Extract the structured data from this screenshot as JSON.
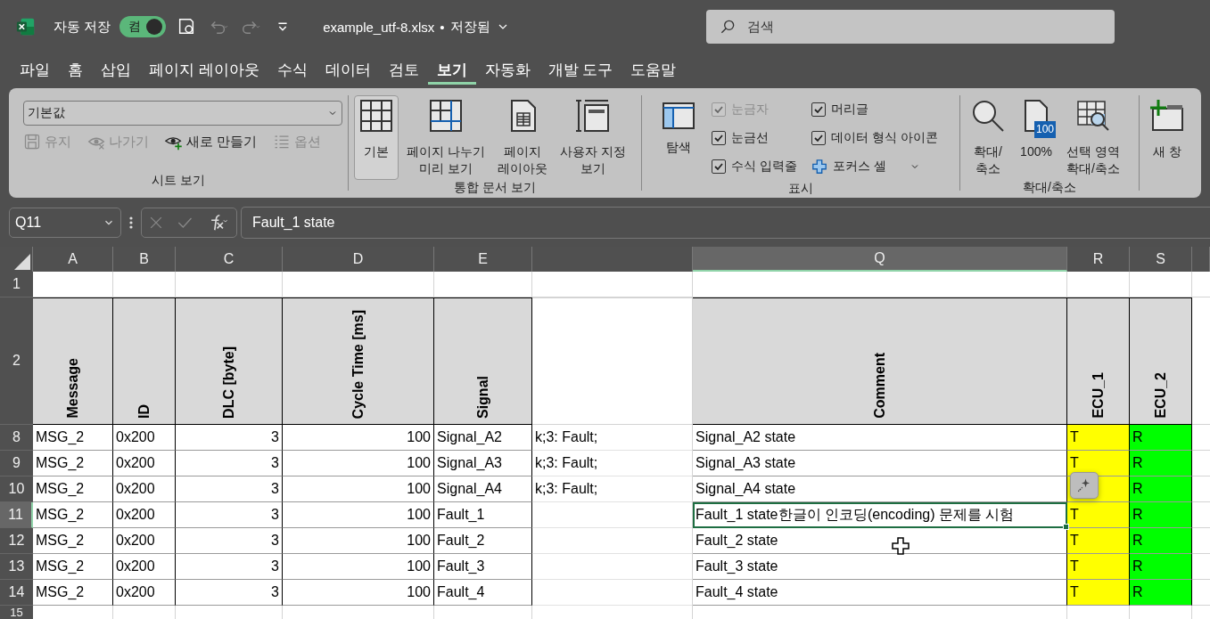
{
  "title_bar": {
    "autosave_label": "자동 저장",
    "autosave": {
      "label": "켬",
      "on": true
    },
    "file_name": "example_utf-8.xlsx",
    "separator": "•",
    "save_status": "저장됨",
    "search_placeholder": "검색"
  },
  "menu": [
    {
      "label": "파일",
      "selected": false
    },
    {
      "label": "홈",
      "selected": false
    },
    {
      "label": "삽입",
      "selected": false
    },
    {
      "label": "페이지 레이아웃",
      "selected": false
    },
    {
      "label": "수식",
      "selected": false
    },
    {
      "label": "데이터",
      "selected": false
    },
    {
      "label": "검토",
      "selected": false
    },
    {
      "label": "보기",
      "selected": true
    },
    {
      "label": "자동화",
      "selected": false
    },
    {
      "label": "개발 도구",
      "selected": false
    },
    {
      "label": "도움말",
      "selected": false
    }
  ],
  "ribbon": {
    "sheet_view": {
      "title": "시트 보기",
      "view_select": "기본값",
      "buttons": [
        {
          "label": "유지",
          "disabled": true
        },
        {
          "label": "나가기",
          "disabled": true
        },
        {
          "label": "새로 만들기",
          "disabled": false
        },
        {
          "label": "옵션",
          "disabled": true
        }
      ]
    },
    "workbook_views": {
      "title": "통합 문서 보기",
      "buttons": [
        {
          "lines": [
            "기본"
          ],
          "selected": true
        },
        {
          "lines": [
            "페이지 나누기",
            "미리 보기"
          ],
          "selected": false
        },
        {
          "lines": [
            "페이지",
            "레이아웃"
          ],
          "selected": false
        },
        {
          "lines": [
            "사용자 지정",
            "보기"
          ],
          "selected": false
        }
      ]
    },
    "show": {
      "title": "표시",
      "navigation": {
        "label": "탐색"
      },
      "checks": [
        {
          "label": "눈금자",
          "checked": true,
          "disabled": true
        },
        {
          "label": "눈금선",
          "checked": true,
          "disabled": false
        },
        {
          "label": "수식 입력줄",
          "checked": true,
          "disabled": false
        },
        {
          "label": "머리글",
          "checked": true,
          "disabled": false
        },
        {
          "label": "데이터 형식 아이콘",
          "checked": true,
          "disabled": false
        }
      ],
      "focus_cell": {
        "label": "포커스 셀"
      }
    },
    "zoom": {
      "title": "확대/축소",
      "buttons": [
        {
          "lines": [
            "확대/",
            "축소"
          ]
        },
        {
          "lines": [
            "100%"
          ],
          "badge": "100"
        },
        {
          "lines": [
            "선택 영역",
            "확대/축소"
          ]
        }
      ]
    },
    "window": {
      "buttons": [
        {
          "lines": [
            "새 창"
          ]
        }
      ]
    }
  },
  "formula_bar": {
    "name_box": "Q11",
    "formula": "Fault_1 state"
  },
  "sheet": {
    "columns": [
      {
        "label": "A",
        "kind": "text"
      },
      {
        "label": "B",
        "kind": "text"
      },
      {
        "label": "C",
        "kind": "number"
      },
      {
        "label": "D",
        "kind": "number"
      },
      {
        "label": "E",
        "kind": "text"
      },
      {
        "kind": "text"
      },
      {
        "label": "Q",
        "kind": "text"
      },
      {
        "label": "R",
        "kind": "text"
      },
      {
        "label": "S",
        "kind": "text"
      }
    ],
    "rows": [
      {
        "number": "1",
        "kind": "empty"
      },
      {
        "number": "2",
        "kind": "header",
        "cells": [
          {
            "text": "Message"
          },
          {
            "text": "ID"
          },
          {
            "text": "DLC [byte]"
          },
          {
            "text": "Cycle Time [ms]"
          },
          {
            "text": "Signal"
          },
          {},
          {
            "text": "Comment"
          },
          {
            "text": "ECU_1"
          },
          {
            "text": "ECU_2"
          }
        ]
      },
      {
        "number": "8",
        "kind": "data",
        "cells": [
          {
            "text": "MSG_2",
            "selected": false
          },
          {
            "text": "0x200",
            "selected": false
          },
          {
            "text": "3",
            "selected": false
          },
          {
            "text": "100",
            "selected": false
          },
          {
            "text": "Signal_A2",
            "selected": false
          },
          {
            "text": "k;3: Fault;",
            "selected": false
          },
          {
            "text": "Signal_A2 state",
            "selected": false
          },
          {
            "text": "T",
            "color": "#ffff00",
            "selected": false
          },
          {
            "text": "R",
            "color": "#00ff00",
            "selected": false
          }
        ]
      },
      {
        "number": "9",
        "kind": "data",
        "cells": [
          {
            "text": "MSG_2",
            "selected": false
          },
          {
            "text": "0x200",
            "selected": false
          },
          {
            "text": "3",
            "selected": false
          },
          {
            "text": "100",
            "selected": false
          },
          {
            "text": "Signal_A3",
            "selected": false
          },
          {
            "text": "k;3: Fault;",
            "selected": false
          },
          {
            "text": "Signal_A3 state",
            "selected": false
          },
          {
            "text": "T",
            "color": "#ffff00",
            "selected": false
          },
          {
            "text": "R",
            "color": "#00ff00",
            "selected": false
          }
        ]
      },
      {
        "number": "10",
        "kind": "data",
        "cells": [
          {
            "text": "MSG_2",
            "selected": false
          },
          {
            "text": "0x200",
            "selected": false
          },
          {
            "text": "3",
            "selected": false
          },
          {
            "text": "100",
            "selected": false
          },
          {
            "text": "Signal_A4",
            "selected": false
          },
          {
            "text": "k;3: Fault;",
            "selected": false
          },
          {
            "text": "Signal_A4 state",
            "selected": false
          },
          {
            "color": "#ffff00",
            "selected": false
          },
          {
            "text": "R",
            "color": "#00ff00",
            "selected": false
          }
        ]
      },
      {
        "number": "11",
        "kind": "data",
        "cells": [
          {
            "text": "MSG_2",
            "selected": false
          },
          {
            "text": "0x200",
            "selected": false
          },
          {
            "text": "3",
            "selected": false
          },
          {
            "text": "100",
            "selected": false
          },
          {
            "text": "Fault_1",
            "selected": false
          },
          {
            "selected": false
          },
          {
            "text": "Fault_1 state한글이 인코딩(encoding) 문제를 시험",
            "selected": true
          },
          {
            "text": "T",
            "color": "#ffff00",
            "selected": false
          },
          {
            "text": "R",
            "color": "#00ff00",
            "selected": false
          }
        ]
      },
      {
        "number": "12",
        "kind": "data",
        "cells": [
          {
            "text": "MSG_2",
            "selected": false
          },
          {
            "text": "0x200",
            "selected": false
          },
          {
            "text": "3",
            "selected": false
          },
          {
            "text": "100",
            "selected": false
          },
          {
            "text": "Fault_2",
            "selected": false
          },
          {
            "selected": false
          },
          {
            "text": "Fault_2 state",
            "selected": false
          },
          {
            "text": "T",
            "color": "#ffff00",
            "selected": false
          },
          {
            "text": "R",
            "color": "#00ff00",
            "selected": false
          }
        ]
      },
      {
        "number": "13",
        "kind": "data",
        "cells": [
          {
            "text": "MSG_2",
            "selected": false
          },
          {
            "text": "0x200",
            "selected": false
          },
          {
            "text": "3",
            "selected": false
          },
          {
            "text": "100",
            "selected": false
          },
          {
            "text": "Fault_3",
            "selected": false
          },
          {
            "selected": false
          },
          {
            "text": "Fault_3 state",
            "selected": false
          },
          {
            "text": "T",
            "color": "#ffff00",
            "selected": false
          },
          {
            "text": "R",
            "color": "#00ff00",
            "selected": false
          }
        ]
      },
      {
        "number": "14",
        "kind": "data",
        "cells": [
          {
            "text": "MSG_2",
            "selected": false
          },
          {
            "text": "0x200",
            "selected": false
          },
          {
            "text": "3",
            "selected": false
          },
          {
            "text": "100",
            "selected": false
          },
          {
            "text": "Fault_4",
            "selected": false
          },
          {
            "selected": false
          },
          {
            "text": "Fault_4 state",
            "selected": false
          },
          {
            "text": "T",
            "color": "#ffff00",
            "selected": false
          },
          {
            "text": "R",
            "color": "#00ff00",
            "selected": false
          }
        ]
      },
      {
        "number": "15",
        "kind": "empty"
      }
    ]
  }
}
